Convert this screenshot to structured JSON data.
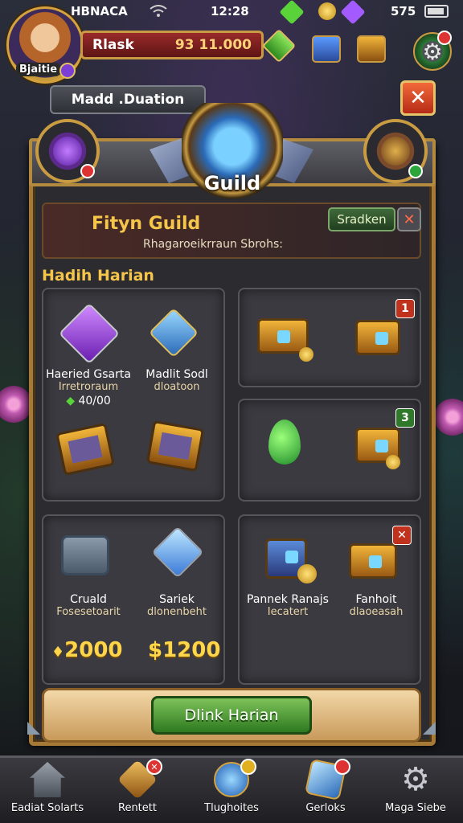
{
  "status": {
    "carrier": "HBNACA",
    "time": "12:28",
    "count": "575"
  },
  "player": {
    "avatar_label": "Bjaitie",
    "name": "Rlask",
    "gold": "93 11.000"
  },
  "mode_label": "Madd .Duation",
  "emblem_label": "Guild",
  "guild": {
    "name": "Fityn Guild",
    "subtitle": "Rhagaroeikrraun Sbrohs:",
    "action_label": "Sradken"
  },
  "section_title": "Hadih Harian",
  "items": [
    {
      "title": "Haeried Gsarta",
      "subtitle": "Irretroraum",
      "extra": "40/00"
    },
    {
      "title": "Madlit Sodl",
      "subtitle": "dloatoon"
    },
    {
      "title": "Cruald",
      "subtitle": "Fosesetoarit",
      "price": "2000"
    },
    {
      "title": "Sariek",
      "subtitle": "dlonenbeht",
      "price": "$1200"
    },
    {
      "title": "Pannek Ranajs",
      "subtitle": "Iecatert"
    },
    {
      "title": "Fanhoit",
      "subtitle": "dlaoeasah"
    }
  ],
  "badges": [
    "1",
    "3",
    "✕"
  ],
  "claim_label": "Dlink Harian",
  "nav": [
    {
      "label": "Eadiat Solarts"
    },
    {
      "label": "Rentett"
    },
    {
      "label": "Tlughoites"
    },
    {
      "label": "Gerloks"
    },
    {
      "label": "Maga Siebe"
    }
  ],
  "colors": {
    "accent_gold": "#f5c64a",
    "panel_border": "#a67a36",
    "claim_green": "#4a9a34",
    "close_red": "#d8432a"
  },
  "icons": [
    "wifi-icon",
    "gem-icon",
    "coin-icon",
    "amethyst-icon",
    "battery-icon",
    "settings-gear-icon",
    "close-icon",
    "home-icon",
    "sword-icon",
    "globe-icon",
    "card-icon",
    "gear-icon"
  ]
}
